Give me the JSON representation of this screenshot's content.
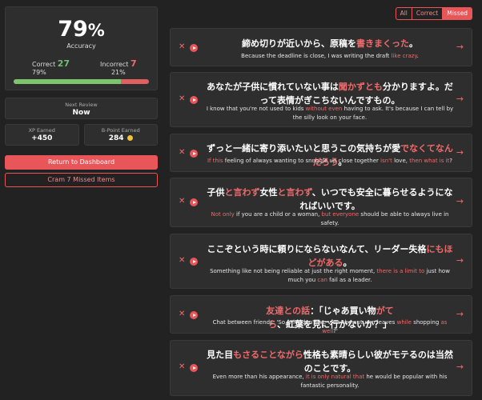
{
  "summary": {
    "accuracy_pct": "79",
    "accuracy_sign": "%",
    "accuracy_label": "Accuracy",
    "correct_label": "Correct",
    "correct_count": "27",
    "correct_pct": "79%",
    "incorrect_label": "Incorrect",
    "incorrect_count": "7",
    "incorrect_pct": "21%",
    "accuracy_fraction": 0.79
  },
  "next_review": {
    "label": "Next Review",
    "value": "Now"
  },
  "xp": {
    "label": "XP Earned",
    "value": "+450"
  },
  "bpoint": {
    "label": "B-Point Earned",
    "value": "284",
    "icon": "coin-icon"
  },
  "buttons": {
    "dashboard": "Return to Dashboard",
    "cram": "Cram 7 Missed Items"
  },
  "filters": [
    "All",
    "Correct",
    "Missed"
  ],
  "items": [
    {
      "jp": [
        {
          "t": "締め切りが近いから、原稿を"
        },
        {
          "t": "書きまくった",
          "h": true
        },
        {
          "t": "。"
        }
      ],
      "en": [
        {
          "t": "Because the deadline is close, I was writing the draft "
        },
        {
          "t": "like crazy",
          "h": true
        },
        {
          "t": "."
        }
      ]
    },
    {
      "jp": [
        {
          "t": "あなたが子供に慣れていない事は"
        },
        {
          "t": "聞かずとも",
          "h": true
        },
        {
          "t": "分かりますよ。だって表情がぎこちないんですもの。"
        }
      ],
      "en": [
        {
          "t": "I know that you're not used to kids "
        },
        {
          "t": "without even",
          "h": true
        },
        {
          "t": " having to ask. It's because I can tell by the silly look on your face."
        }
      ]
    },
    {
      "jp": [
        {
          "t": "ずっと一緒に寄り添いたいと思うこの気持ちが愛"
        },
        {
          "t": "でなくてなんだろう",
          "h": true
        },
        {
          "t": "。"
        }
      ],
      "en": [
        {
          "t": "If this",
          "h": true
        },
        {
          "t": " feeling of always wanting to snuggle up close together "
        },
        {
          "t": "isn't",
          "h": true
        },
        {
          "t": " love, "
        },
        {
          "t": "then what is it",
          "h": true
        },
        {
          "t": "?"
        }
      ]
    },
    {
      "jp": [
        {
          "t": "子供"
        },
        {
          "t": "と言わず",
          "h": true
        },
        {
          "t": "女性"
        },
        {
          "t": "と言わず",
          "h": true
        },
        {
          "t": "、いつでも安全に暮らせるようになればいいです。"
        }
      ],
      "en": [
        {
          "t": "Not only",
          "h": true
        },
        {
          "t": " if you are a child or a woman, "
        },
        {
          "t": "but everyone",
          "h": true
        },
        {
          "t": " should be able to always live in safety."
        }
      ]
    },
    {
      "jp": [
        {
          "t": "ここぞという時に頼りにならないなんて、リーダー失格"
        },
        {
          "t": "にもほどがある",
          "h": true
        },
        {
          "t": "。"
        }
      ],
      "en": [
        {
          "t": "Something like not being reliable at just the right moment, "
        },
        {
          "t": "there is a limit to",
          "h": true
        },
        {
          "t": " just how much you "
        },
        {
          "t": "can",
          "h": true
        },
        {
          "t": " fail as a leader."
        }
      ]
    },
    {
      "jp": [
        {
          "t": "友達との話",
          "h": true
        },
        {
          "t": "：「じゃあ買い物"
        },
        {
          "t": "がてら",
          "h": true
        },
        {
          "t": "、紅葉を見に行かないか？」"
        }
      ],
      "en": [
        {
          "t": "Chat between friends: 'So, why don't we view the autumn leaves "
        },
        {
          "t": "while",
          "h": true
        },
        {
          "t": " shopping "
        },
        {
          "t": "as well",
          "h": true
        },
        {
          "t": "?'"
        }
      ]
    },
    {
      "jp": [
        {
          "t": "見た目"
        },
        {
          "t": "もさることながら",
          "h": true
        },
        {
          "t": "性格も素晴らしい彼がモテるのは当然のことです。"
        }
      ],
      "en": [
        {
          "t": "Even more than his appearance, "
        },
        {
          "t": "it is only natural that",
          "h": true
        },
        {
          "t": " he would be popular with his fantastic personality."
        }
      ]
    }
  ]
}
